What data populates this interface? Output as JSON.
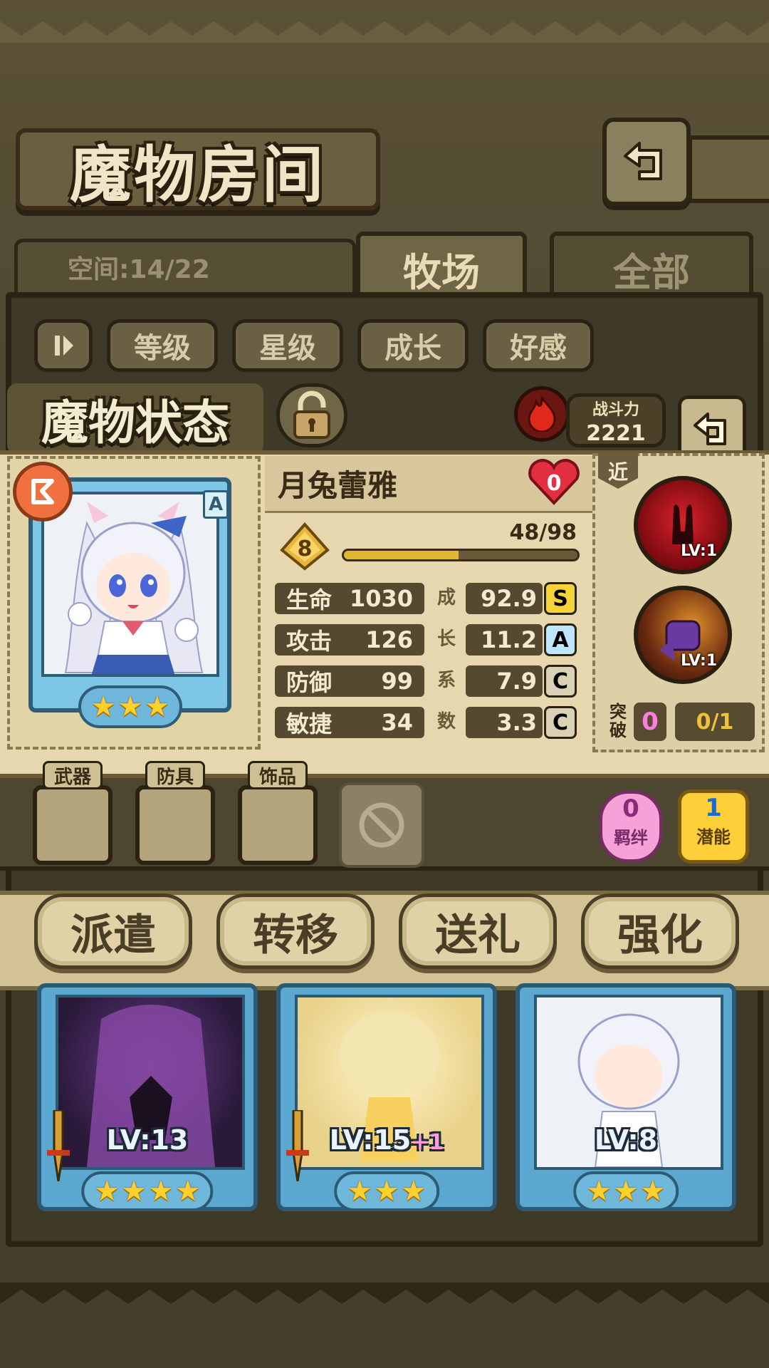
{
  "header": {
    "title": "魔物房间"
  },
  "tabs": {
    "space_label": "空间:14/22",
    "ranch": "牧场",
    "all": "全部"
  },
  "filters": [
    "等级",
    "星级",
    "成长",
    "好感"
  ],
  "status": {
    "title": "魔物状态",
    "power_label": "战斗力",
    "power_value": "2221"
  },
  "monster": {
    "name": "月兔蕾雅",
    "affection": "0",
    "rank": "A",
    "level": "8",
    "exp_text": "48/98",
    "exp_fraction": 0.49,
    "stars": 3,
    "growth_label_chars": [
      "成",
      "长",
      "系",
      "数"
    ],
    "stats": [
      {
        "label": "生命",
        "value": "1030",
        "growth": "92.9",
        "grade": "S"
      },
      {
        "label": "攻击",
        "value": "126",
        "growth": "11.2",
        "grade": "A"
      },
      {
        "label": "防御",
        "value": "99",
        "growth": "7.9",
        "grade": "C"
      },
      {
        "label": "敏捷",
        "value": "34",
        "growth": "3.3",
        "grade": "C"
      }
    ]
  },
  "skills": {
    "range_tag": "近",
    "items": [
      {
        "icon": "moon-rabbit-skill-icon",
        "level": "LV:1"
      },
      {
        "icon": "fist-skill-icon",
        "level": "LV:1"
      }
    ],
    "breakthrough_label": "突破",
    "breakthrough_value": "0",
    "breakthrough_ratio": "0/1"
  },
  "equipment": {
    "slots": [
      "武器",
      "防具",
      "饰品"
    ],
    "bond_value": "0",
    "bond_label": "羁绊",
    "potential_value": "1",
    "potential_label": "潜能"
  },
  "actions": [
    "派遣",
    "转移",
    "送礼",
    "强化"
  ],
  "list_cards": [
    {
      "level": "LV:13",
      "plus": "",
      "stars": 4,
      "theme": "dark"
    },
    {
      "level": "LV:15",
      "plus": "+1",
      "stars": 3,
      "theme": "light"
    },
    {
      "level": "LV:8",
      "plus": "",
      "stars": 3,
      "theme": "rabbit"
    }
  ],
  "colors": {
    "grade_S": "#f5d23a",
    "grade_A": "#bfe6ff",
    "grade_C": "#d9d0b6",
    "accent": "#e0b834"
  }
}
